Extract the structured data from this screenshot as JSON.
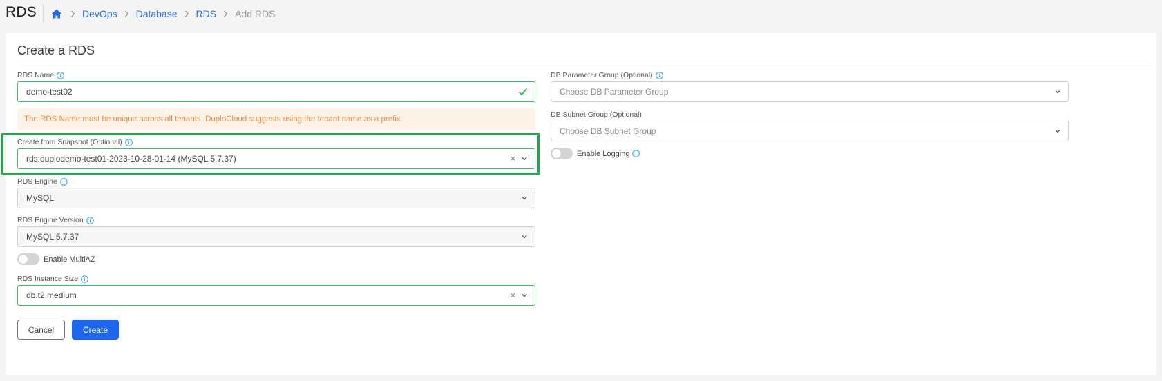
{
  "header": {
    "title": "RDS",
    "breadcrumb": {
      "home_icon": "home-icon",
      "items": [
        "DevOps",
        "Database",
        "RDS"
      ],
      "current": "Add RDS"
    }
  },
  "form": {
    "title": "Create a RDS",
    "rds_name": {
      "label": "RDS Name",
      "value": "demo-test02"
    },
    "alert": "The RDS Name must be unique across all tenants. DuploCloud suggests using the tenant name as a prefix.",
    "snapshot": {
      "label": "Create from Snapshot (Optional)",
      "value": "rds:duplodemo-test01-2023-10-28-01-14 (MySQL 5.7.37)"
    },
    "engine": {
      "label": "RDS Engine",
      "value": "MySQL"
    },
    "engine_version": {
      "label": "RDS Engine Version",
      "value": "MySQL 5.7.37"
    },
    "multiaz": {
      "label": "Enable MultiAZ",
      "enabled": false
    },
    "instance_size": {
      "label": "RDS Instance Size",
      "value": "db.t2.medium"
    },
    "param_group": {
      "label": "DB Parameter Group (Optional)",
      "placeholder": "Choose DB Parameter Group"
    },
    "subnet_group": {
      "label": "DB Subnet Group (Optional)",
      "placeholder": "Choose DB Subnet Group"
    },
    "logging": {
      "label": "Enable Logging",
      "enabled": false
    },
    "clear_glyph": "×",
    "buttons": {
      "cancel": "Cancel",
      "create": "Create"
    }
  },
  "colors": {
    "accent": "#1e66ee",
    "valid_border": "#3fb96a",
    "highlight": "#22a74a",
    "alert_text": "#ef8a43",
    "alert_bg": "#fdf3e9",
    "info_icon": "#2aa3d9"
  }
}
